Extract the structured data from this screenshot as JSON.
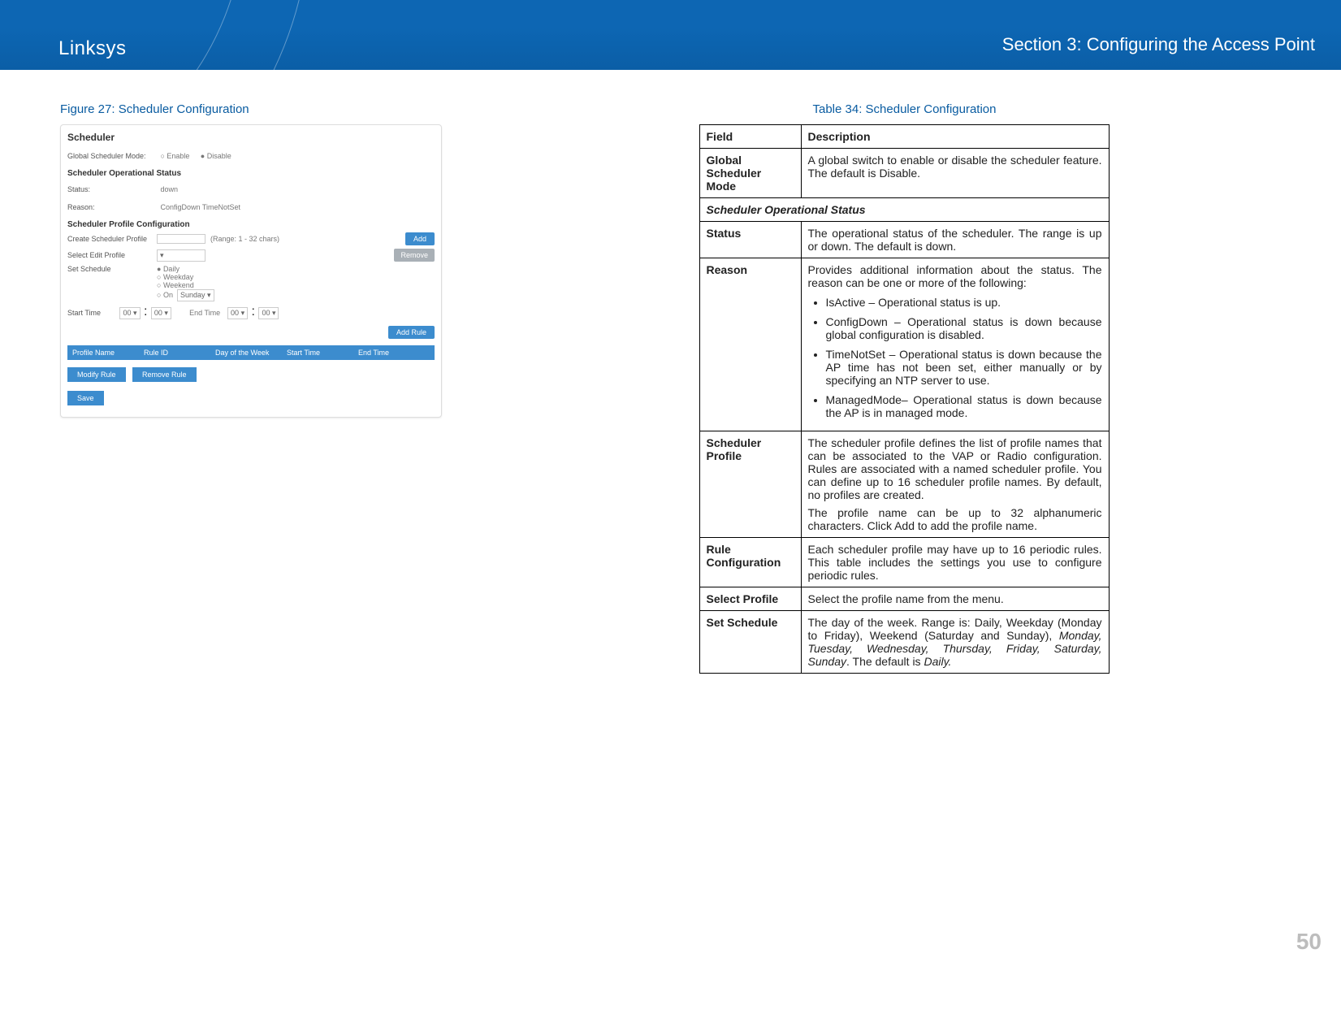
{
  "banner": {
    "brand": "Linksys",
    "section_label": "Section 3:  Configuring the Access Point"
  },
  "page_number": "50",
  "figure_caption": "Figure 27: Scheduler Configuration",
  "table_caption": "Table 34: Scheduler Configuration",
  "shot": {
    "title": "Scheduler",
    "mode_label": "Global Scheduler Mode:",
    "mode_enable": "Enable",
    "mode_disable": "Disable",
    "opstatus_head": "Scheduler Operational Status",
    "status_label": "Status:",
    "status_val": "down",
    "reason_label": "Reason:",
    "reason_val": "ConfigDown TimeNotSet",
    "profile_head": "Scheduler Profile Configuration",
    "create_label": "Create Scheduler Profile",
    "create_range": "(Range: 1 - 32 chars)",
    "add_btn": "Add",
    "select_label": "Select Edit Profile",
    "remove_btn": "Remove",
    "setsched_label": "Set Schedule",
    "opt_daily": "Daily",
    "opt_weekday": "Weekday",
    "opt_weekend": "Weekend",
    "opt_on": "On",
    "opt_on_val": "Sunday",
    "start_label": "Start Time",
    "end_label": "End Time",
    "time_hh": "00",
    "time_mm": "00",
    "addrule_btn": "Add Rule",
    "col_profile": "Profile Name",
    "col_rule": "Rule ID",
    "col_dow": "Day of the Week",
    "col_start": "Start Time",
    "col_end": "End Time",
    "modify_btn": "Modify Rule",
    "remove_rule_btn": "Remove Rule",
    "save_btn": "Save"
  },
  "tbl": {
    "h_field": "Field",
    "h_desc": "Description",
    "r1_field": "Global Scheduler Mode",
    "r1_desc": "A global switch to enable or disable the scheduler feature. The default is Disable.",
    "subhead": "Scheduler Operational Status",
    "r2_field": "Status",
    "r2_desc": "The operational status of the scheduler. The range is up or down. The default is down.",
    "r3_field": "Reason",
    "r3_intro": "Provides additional information about the status. The reason can be one or more of the following:",
    "r3_b1": "IsActive – Operational status is up.",
    "r3_b2": "ConfigDown – Operational status is down because global configuration is disabled.",
    "r3_b3": "TimeNotSet – Operational status is down because the AP time has not been set, either manually or by specifying an NTP server to use.",
    "r3_b4": "ManagedMode– Operational status is down because the AP is in managed mode.",
    "r4_field": "Scheduler Profile",
    "r4_p1": "The scheduler profile defines the list of profile names that can be associated to the VAP or Radio configuration. Rules are associated with a named scheduler profile. You can define up to 16 scheduler profile names. By default, no profiles are created.",
    "r4_p2": "The profile name can be up to 32 alphanumeric characters. Click Add to add the profile name.",
    "r5_field": "Rule Configuration",
    "r5_desc": "Each scheduler profile may have up to 16 periodic rules. This table includes the settings you use to configure periodic rules.",
    "r6_field": "Select Profile",
    "r6_desc": "Select the profile name from the menu.",
    "r7_field": "Set Schedule",
    "r7_p1a": "The day of the week. Range is: Daily, Weekday (Monday to Friday), Weekend (Saturday and Sunday), ",
    "r7_p1_ital": "Monday, Tuesday, Wednesday, Thursday, Friday, Saturday, Sunday",
    "r7_p1b": ". The default is ",
    "r7_p1_ital2": "Daily."
  }
}
